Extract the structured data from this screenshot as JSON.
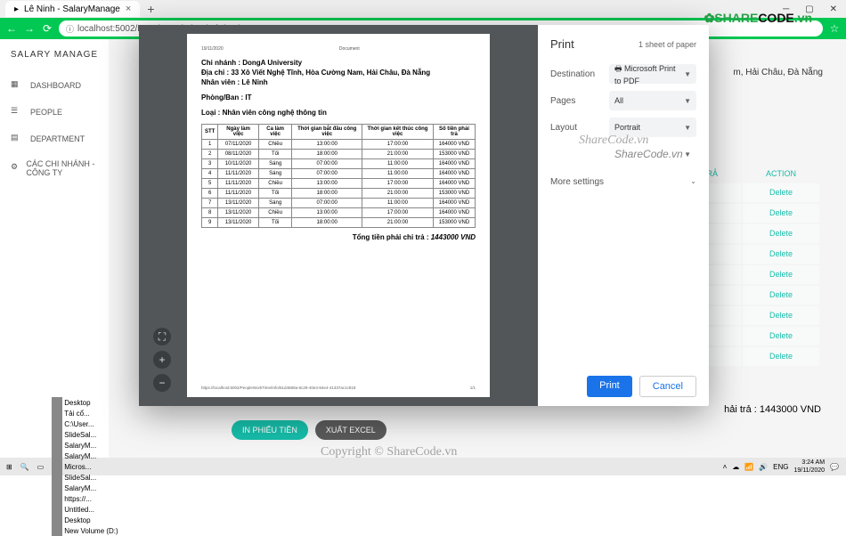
{
  "browser": {
    "tab_title": "Lê Ninh - SalaryManage",
    "url": "localhost:5002/PeopleWorkTime/Info/61d4688a-6c29-40e4-84e4-41337ac1c819"
  },
  "sidebar": {
    "app_name": "SALARY MANAGE",
    "items": [
      "DASHBOARD",
      "PEOPLE",
      "DEPARTMENT",
      "CÁC CHI NHÁNH - CÔNG TY"
    ]
  },
  "bg": {
    "addr_tail": "m, Hải Châu, Đà Nẵng",
    "col_tra": "TRẢ",
    "col_action": "ACTION",
    "delete": "Delete",
    "total": "hải trả : 1443000 VND",
    "btn_print": "IN PHIẾU TIỀN",
    "btn_excel": "XUẤT EXCEL"
  },
  "doc": {
    "date_hdr": "19/11/2020",
    "title_hdr": "Document",
    "chi_nhanh_label": "Chi nhánh :",
    "chi_nhanh": "DongA University",
    "dia_chi_label": "Địa chỉ :",
    "dia_chi": "33 Xô Viết Nghệ Tĩnh, Hòa Cường Nam, Hải Châu, Đà Nẵng",
    "nhan_vien_label": "Nhân viên :",
    "nhan_vien": "Lê Ninh",
    "phong_ban_label": "Phòng/Ban :",
    "phong_ban": "IT",
    "loai_label": "Loại :",
    "loai": "Nhân viên công nghệ thông tin",
    "cols": [
      "STT",
      "Ngày làm việc",
      "Ca làm việc",
      "Thời gian bắt đầu công việc",
      "Thời gian kết thúc công việc",
      "Số tiền phải trả"
    ],
    "rows": [
      [
        "1",
        "07/11/2020",
        "Chiều",
        "13:00:00",
        "17:00:00",
        "164000 VND"
      ],
      [
        "2",
        "08/11/2020",
        "Tối",
        "18:00:00",
        "21:00:00",
        "153000 VND"
      ],
      [
        "3",
        "10/11/2020",
        "Sáng",
        "07:00:00",
        "11:00:00",
        "164000 VND"
      ],
      [
        "4",
        "11/11/2020",
        "Sáng",
        "07:00:00",
        "11:00:00",
        "164000 VND"
      ],
      [
        "5",
        "11/11/2020",
        "Chiều",
        "13:00:00",
        "17:00:00",
        "164000 VND"
      ],
      [
        "6",
        "11/11/2020",
        "Tối",
        "18:00:00",
        "21:00:00",
        "153000 VND"
      ],
      [
        "7",
        "13/11/2020",
        "Sáng",
        "07:00:00",
        "11:00:00",
        "164000 VND"
      ],
      [
        "8",
        "13/11/2020",
        "Chiều",
        "13:00:00",
        "17:00:00",
        "164000 VND"
      ],
      [
        "9",
        "13/11/2020",
        "Tối",
        "18:00:00",
        "21:00:00",
        "153000 VND"
      ]
    ],
    "total_label": "Tổng tiền phải chi trả :",
    "total_value": "1443000 VND",
    "footer_url": "https://localhost:5002/PeopleWorkTime/Info/61d4688a-6c29-40e4-84e4-41337ac1c819",
    "page_num": "1/1"
  },
  "print": {
    "title": "Print",
    "count": "1 sheet of paper",
    "dest_label": "Destination",
    "dest_value": "Microsoft Print to PDF",
    "pages_label": "Pages",
    "pages_value": "All",
    "layout_label": "Layout",
    "layout_value": "Portrait",
    "color_label": "",
    "color_value": "ShareCode.vn",
    "more": "More settings",
    "btn_print": "Print",
    "btn_cancel": "Cancel"
  },
  "watermark": {
    "logo1": "SHARE",
    "logo2": "CODE",
    "logo3": ".vn",
    "text": "ShareCode.vn",
    "copyright": "Copyright © ShareCode.vn"
  },
  "taskbar": {
    "items": [
      "Desktop",
      "Tải cổ...",
      "C:\\User...",
      "SlideSal...",
      "SalaryM...",
      "SalaryM...",
      "Micros...",
      "SlideSal...",
      "SalaryM...",
      "https://...",
      "Untitled...",
      "Desktop",
      "New Volume (D:)"
    ],
    "lang": "ENG",
    "time": "3:24 AM",
    "date": "19/11/2020"
  }
}
